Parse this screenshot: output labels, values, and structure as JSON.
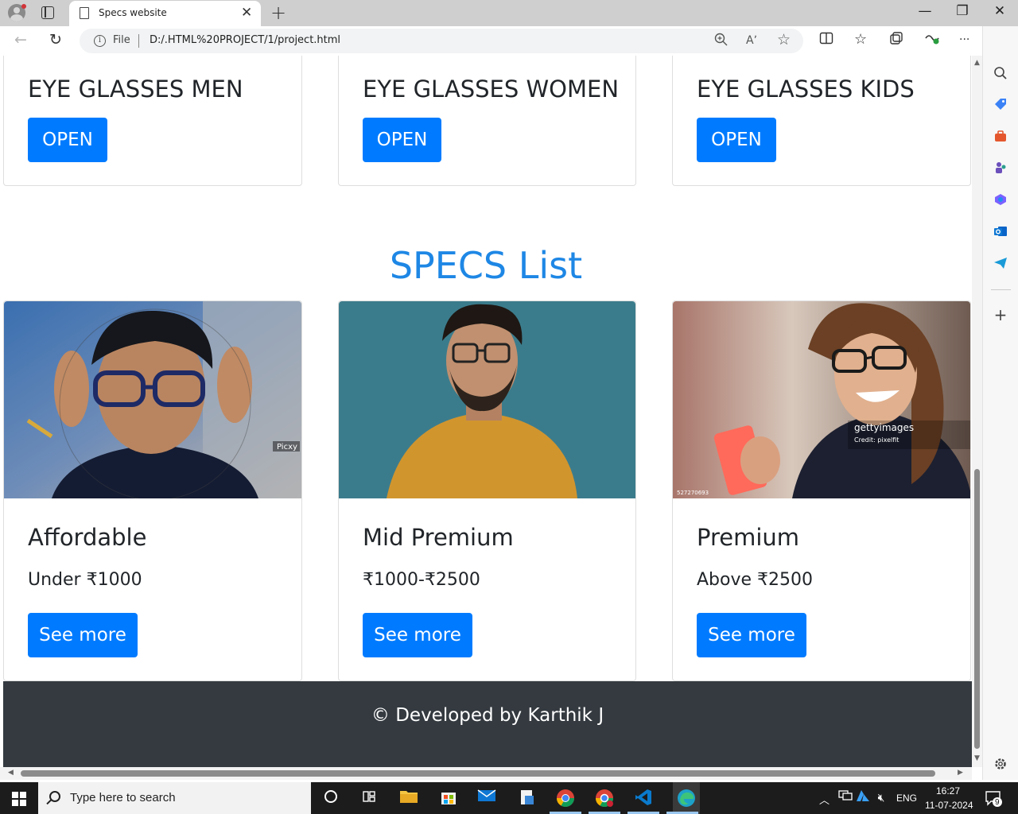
{
  "browser": {
    "tab_title": "Specs website",
    "tab_close": "✕",
    "new_tab": "+",
    "window_controls": {
      "minimize": "—",
      "restore": "❐",
      "close": "✕"
    },
    "address": {
      "scheme_label": "File",
      "url": "D:/.HTML%20PROJECT/1/project.html"
    },
    "nav": {
      "back": "←",
      "reload": "↻"
    },
    "toolbar_icons": [
      "zoom-icon",
      "read-aloud-icon",
      "favorite-star-icon",
      "split-screen-icon",
      "favorites-icon",
      "collections-icon",
      "extensions-icon",
      "more-icon",
      "copilot-icon"
    ],
    "read_aloud_glyph": "Aʼ",
    "more_glyph": "···"
  },
  "page": {
    "categories": [
      {
        "title": "EYE GLASSES MEN",
        "button": "OPEN"
      },
      {
        "title": "EYE GLASSES WOMEN",
        "button": "OPEN"
      },
      {
        "title": "EYE GLASSES KIDS",
        "button": "OPEN"
      }
    ],
    "section_heading": "SPECS List",
    "specs": [
      {
        "title": "Affordable",
        "price": "Under ₹1000",
        "button": "See more",
        "image_watermark": "Picxy"
      },
      {
        "title": "Mid Premium",
        "price": "₹1000-₹2500",
        "button": "See more"
      },
      {
        "title": "Premium",
        "price": "Above ₹2500",
        "button": "See more",
        "image_watermark": "gettyimages",
        "image_credit": "Credit: pixelfit",
        "image_id": "527270693"
      }
    ],
    "footer": "© Developed by Karthik J",
    "colors": {
      "primary": "#007bff",
      "heading": "#1e87e5",
      "footer_bg": "#343a40"
    }
  },
  "sidebar": {
    "icons": [
      "search-icon",
      "shopping-tag-icon",
      "tools-icon",
      "games-icon",
      "microsoft365-icon",
      "outlook-icon",
      "telegram-icon",
      "add-icon",
      "settings-icon"
    ]
  },
  "taskbar": {
    "search_placeholder": "Type here to search",
    "language": "ENG",
    "time": "16:27",
    "date": "11-07-2024",
    "notification_count": "9"
  }
}
